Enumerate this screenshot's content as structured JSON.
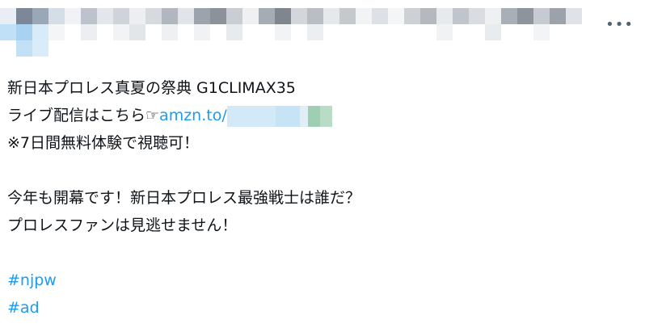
{
  "tweet": {
    "author": "",
    "more_icon": "more-horizontal-icon",
    "line1": "新日本プロレス真夏の祭典 G1CLIMAX35",
    "line2_prefix": "ライブ配信はこちら☞",
    "line2_link": "amzn.to/",
    "line3": "※7日間無料体験で視聴可！",
    "line4": "今年も開幕です！新日本プロレス最強戦士は誰だ？",
    "line5": "プロレスファンは見逃せません！",
    "hashtags": [
      "#njpw",
      "#ad"
    ]
  },
  "colors": {
    "link": "#1d9bf0",
    "text": "#0f1419",
    "icon": "#536471"
  }
}
